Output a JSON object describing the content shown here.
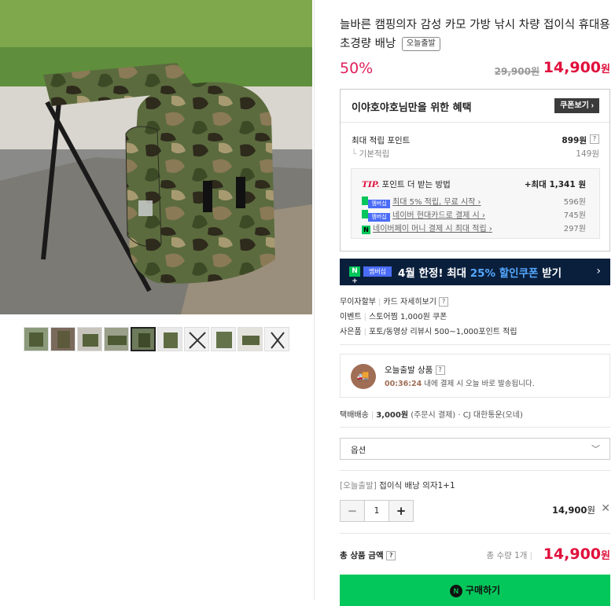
{
  "product": {
    "title": "늘바른 캠핑의자 감성 카모 가방 낚시 차량 접이식 휴대용 초경량 배낭",
    "badge": "오늘출발",
    "discount": "50%",
    "original_price": "29,900원",
    "price_number": "14,900",
    "price_unit": "원"
  },
  "benefit": {
    "header": "이야호야호님만을 위한 혜택",
    "coupon_button": "쿠폰보기 ›",
    "max_points_label": "최대 적립 포인트",
    "max_points_value": "899원",
    "base_label": "기본적립",
    "base_value": "149원",
    "tip_label": "TIP.",
    "tip_title": "포인트 더 받는 방법",
    "tip_max": "+최대 1,341 원",
    "tips": [
      {
        "label": "최대 5% 적립, 무료 시작 ›",
        "value": "596원"
      },
      {
        "label": "네이버 현대카드로 결제 시 ›",
        "value": "745원"
      },
      {
        "label": "네이버페이 머니 결제 시 최대 적립 ›",
        "value": "297원"
      }
    ],
    "membership_tag": "멤버십",
    "npay_tag": "N"
  },
  "banner": {
    "tag_n": "N +",
    "tag_membership": "멤버십",
    "text_pre": "4월 한정! 최대 ",
    "text_highlight": "25% 할인쿠폰",
    "text_post": " 받기",
    "chevron": "›"
  },
  "info": [
    {
      "key": "무이자할부",
      "value": "카드 자세히보기"
    },
    {
      "key": "이벤트",
      "value": "스토어찜 1,000원 쿠폰"
    },
    {
      "key": "사은품",
      "value": "포토/동영상 리뷰시 500~1,000포인트 적립"
    }
  ],
  "delivery": {
    "title": "오늘출발 상품",
    "time": "00:36:24",
    "sub": " 내에 결제 시 오늘 바로 발송됩니다.",
    "shipping_key": "택배배송",
    "shipping_price": "3,000원",
    "shipping_note": " (주문시 결제)",
    "shipping_carrier": " · CJ 대한통운(오네)"
  },
  "option": {
    "select_label": "옵션",
    "selected_prefix": "[오늘출발]",
    "selected_name": " 접이식 배낭 의자1+1",
    "quantity": "1",
    "minus": "−",
    "plus": "+",
    "line_price": "14,900",
    "line_unit": "원",
    "remove": "✕"
  },
  "total": {
    "label": "총 상품 금액",
    "count": "총 수량 1개",
    "price_number": "14,900",
    "price_unit": "원"
  },
  "buy_button": "구매하기",
  "colors": {
    "accent_red": "#e0103c",
    "naver_green": "#03c75a",
    "banner_navy": "#0a1f3c"
  }
}
